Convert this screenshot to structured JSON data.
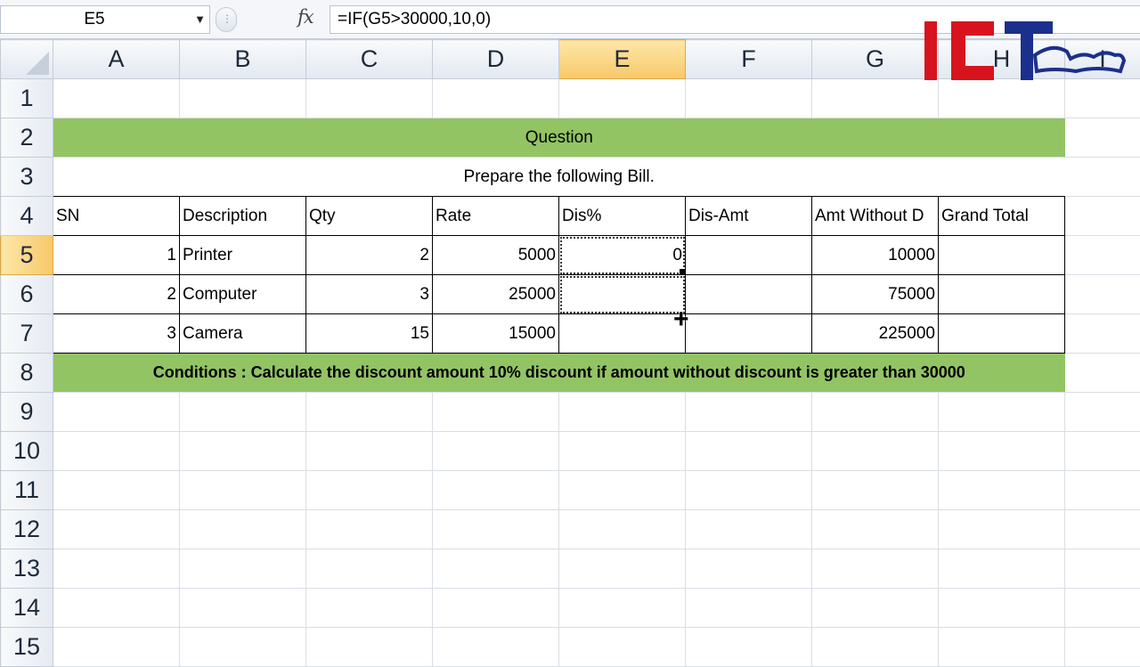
{
  "formula_bar": {
    "name_box": "E5",
    "name_box_arrow": "▼",
    "fx": "fx",
    "formula": "=IF(G5>30000,10,0)"
  },
  "columns": [
    "A",
    "B",
    "C",
    "D",
    "E",
    "F",
    "G",
    "H",
    "I"
  ],
  "rows": [
    "1",
    "2",
    "3",
    "4",
    "5",
    "6",
    "7",
    "8",
    "9",
    "10",
    "11",
    "12",
    "13",
    "14",
    "15"
  ],
  "sheet": {
    "question": "Question",
    "subtitle": "Prepare the following Bill.",
    "headers": [
      "SN",
      "Description",
      "Qty",
      "Rate",
      "Dis%",
      "Dis-Amt",
      "Amt Without D",
      "Grand Total"
    ],
    "items": [
      {
        "sn": "1",
        "description": "Printer",
        "qty": "2",
        "rate": "5000",
        "dis_pct": "0",
        "dis_amt": "",
        "amt_without": "10000",
        "grand_total": ""
      },
      {
        "sn": "2",
        "description": "Computer",
        "qty": "3",
        "rate": "25000",
        "dis_pct": "",
        "dis_amt": "",
        "amt_without": "75000",
        "grand_total": ""
      },
      {
        "sn": "3",
        "description": "Camera",
        "qty": "15",
        "rate": "15000",
        "dis_pct": "",
        "dis_amt": "",
        "amt_without": "225000",
        "grand_total": ""
      }
    ],
    "conditions": "Conditions : Calculate the discount amount 10% discount if amount without discount is greater than 30000"
  },
  "selection": {
    "active_cell": "E5",
    "active_column": "E",
    "active_row": "5"
  },
  "logo": {
    "text": "ICT Trends",
    "colors": {
      "red": "#d7141e",
      "blue": "#1b2f8c"
    }
  },
  "colors": {
    "banner_green": "#92c464",
    "header_active": "#f7c868"
  }
}
